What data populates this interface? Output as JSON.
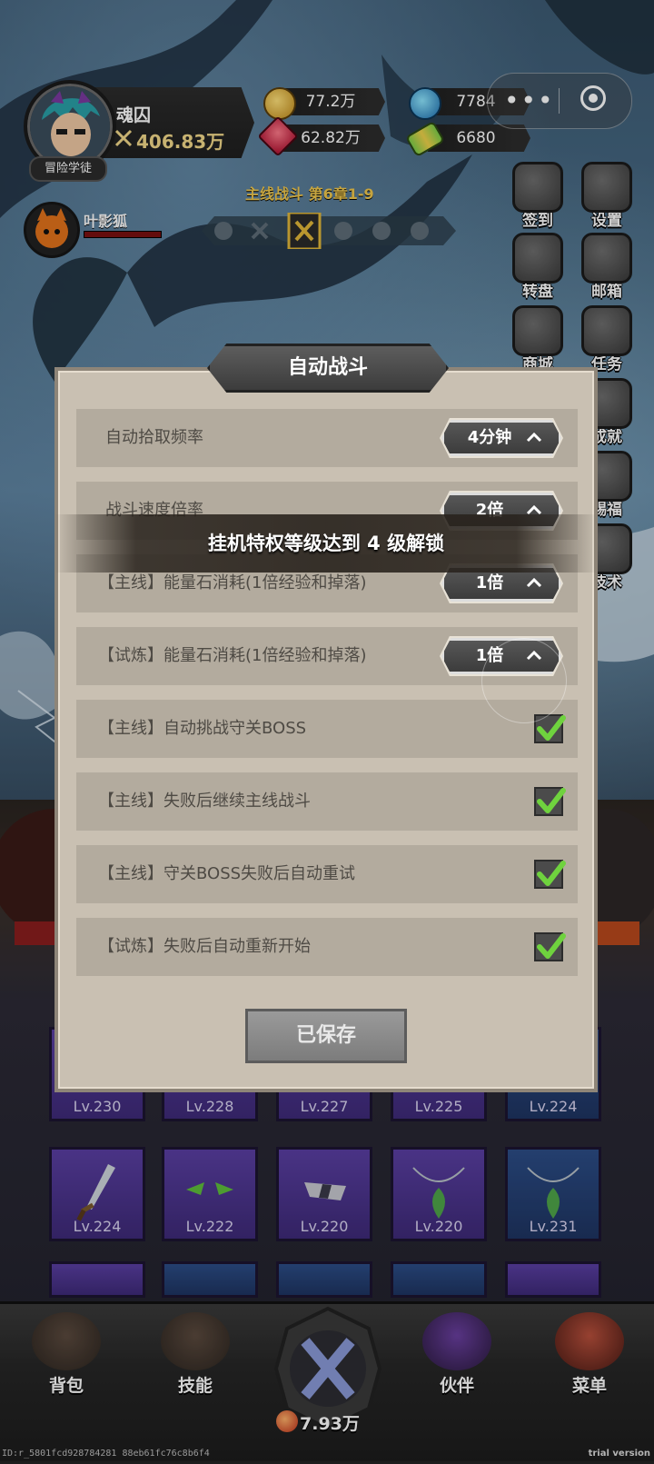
{
  "player": {
    "name": "魂囚",
    "power": "406.83万",
    "title": "冒险学徒"
  },
  "currencies": {
    "gold": "77.2万",
    "orb": "7784",
    "gem": "62.82万",
    "green": "6680"
  },
  "stage": {
    "title": "主线战斗 第6章1-9"
  },
  "companion": {
    "name": "叶影狐"
  },
  "side_buttons": [
    {
      "label": "签到",
      "icon": "calendar-icon"
    },
    {
      "label": "设置",
      "icon": "gear-icon"
    },
    {
      "label": "转盘",
      "icon": "wheel-icon"
    },
    {
      "label": "邮箱",
      "icon": "mail-icon"
    },
    {
      "label": "商城",
      "icon": "shop-icon"
    },
    {
      "label": "任务",
      "icon": "scroll-icon"
    },
    {
      "label": "成就",
      "icon": "laurel-icon"
    },
    {
      "label": "赐福",
      "icon": "blessing-icon"
    },
    {
      "label": "技术",
      "icon": "gear-icon"
    }
  ],
  "modal": {
    "title": "自动战斗",
    "lock_message": "挂机特权等级达到 4 级解锁",
    "rows": [
      {
        "label": "自动拾取频率",
        "value": "4分钟"
      },
      {
        "label": "战斗速度倍率",
        "value": "2倍"
      },
      {
        "label": "【主线】能量石消耗(1倍经验和掉落)",
        "value": "1倍"
      },
      {
        "label": "【试炼】能量石消耗(1倍经验和掉落)",
        "value": "1倍"
      }
    ],
    "toggles": [
      {
        "label": "【主线】自动挑战守关BOSS",
        "checked": true
      },
      {
        "label": "【主线】失败后继续主线战斗",
        "checked": true
      },
      {
        "label": "【主线】守关BOSS失败后自动重试",
        "checked": true
      },
      {
        "label": "【试炼】失败后自动重新开始",
        "checked": true
      }
    ],
    "save_label": "已保存"
  },
  "items_row1": [
    "Lv.230",
    "Lv.228",
    "Lv.227",
    "Lv.225",
    "Lv.224"
  ],
  "items_row2": [
    "Lv.224",
    "Lv.222",
    "Lv.220",
    "Lv.220",
    "Lv.231"
  ],
  "nav": {
    "bag": "背包",
    "skills": "技能",
    "battle_power": "7.93万",
    "partner": "伙伴",
    "menu": "菜单"
  },
  "footer": {
    "id": "ID:r_5801fcd928784281 88eb61fc76c8b6f4",
    "trial": "trial version"
  },
  "colors": {
    "panel": "#c9c0b2",
    "row": "#b3ab9e",
    "accent_gold": "#f1c84e",
    "check_green": "#6fd23e"
  }
}
